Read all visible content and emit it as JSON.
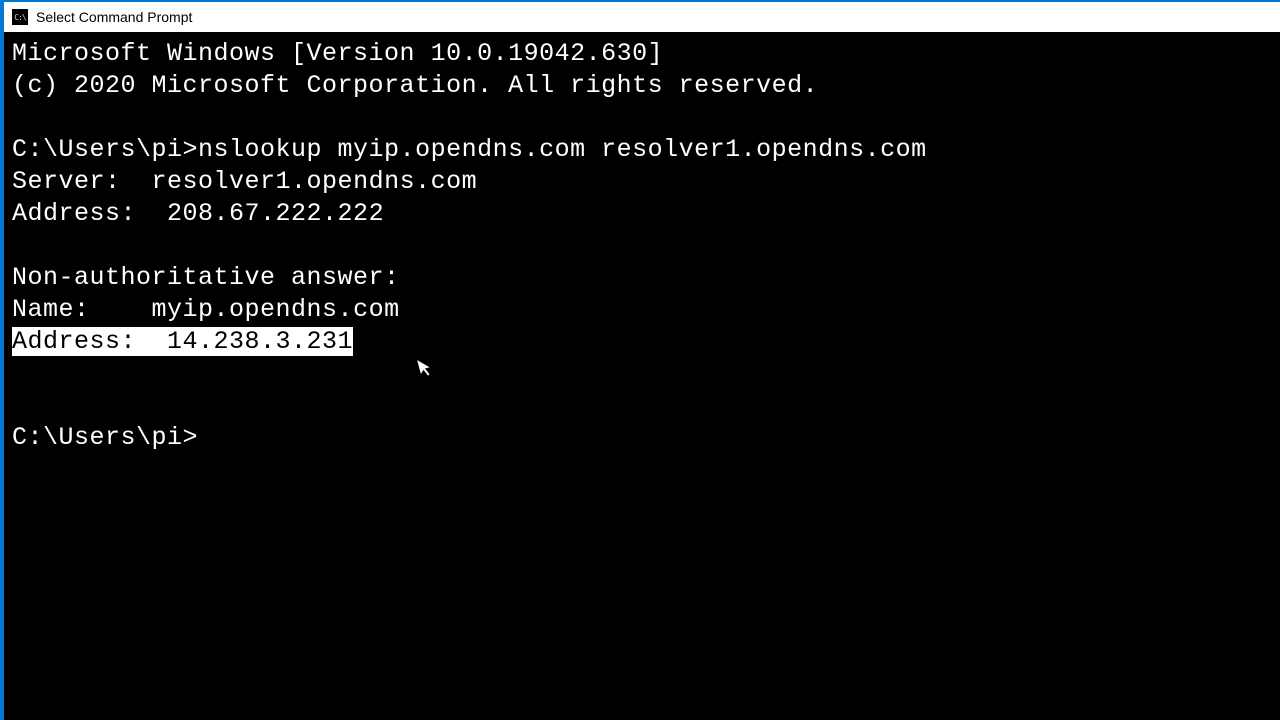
{
  "window": {
    "title": "Select Command Prompt"
  },
  "terminal": {
    "banner_line1": "Microsoft Windows [Version 10.0.19042.630]",
    "banner_line2": "(c) 2020 Microsoft Corporation. All rights reserved.",
    "prompt1_path": "C:\\Users\\pi>",
    "prompt1_command": "nslookup myip.opendns.com resolver1.opendns.com",
    "server_label": "Server:  ",
    "server_value": "resolver1.opendns.com",
    "address1_label": "Address:  ",
    "address1_value": "208.67.222.222",
    "nonauth_label": "Non-authoritative answer:",
    "name_label": "Name:    ",
    "name_value": "myip.opendns.com",
    "address2_selected": "Address:  14.238.3.231",
    "prompt2": "C:\\Users\\pi>"
  }
}
